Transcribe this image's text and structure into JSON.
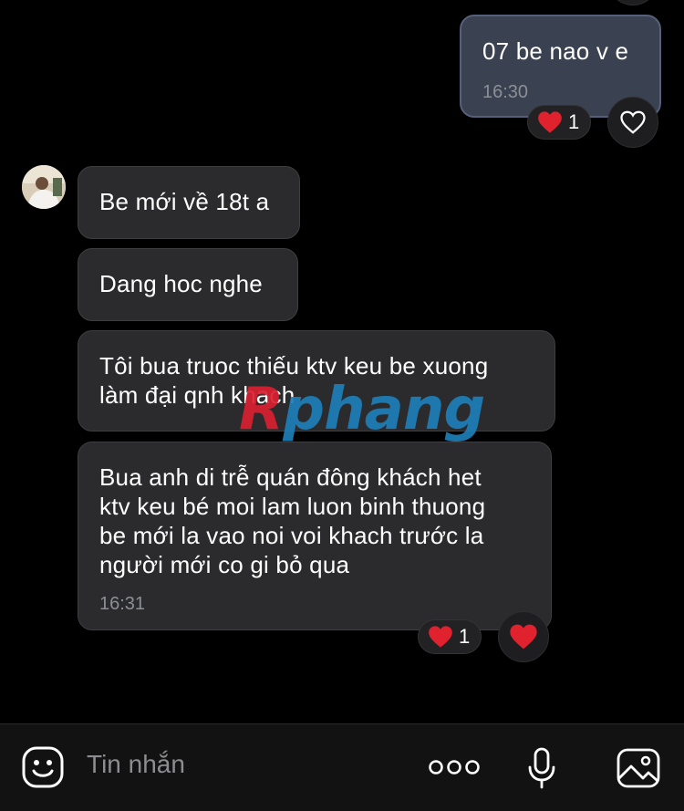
{
  "messages": [
    {
      "id": "m1",
      "direction": "outgoing",
      "text": "07 be nao v e",
      "time": "16:30",
      "reaction": {
        "emoji": "heart",
        "count": "1"
      }
    },
    {
      "id": "m2",
      "direction": "incoming",
      "text": "Be mới về 18t a"
    },
    {
      "id": "m3",
      "direction": "incoming",
      "text": "Dang hoc nghe"
    },
    {
      "id": "m4",
      "direction": "incoming",
      "text": "Tôi bua truoc thiếu ktv keu be xuong\nlàm đại qnh khach"
    },
    {
      "id": "m5",
      "direction": "incoming",
      "text": "Bua anh di trễ quán đông khách het\nktv keu bé moi lam luon binh thuong\nbe mới la vao noi voi khach trước la\nngười mới co gi bỏ qua",
      "time": "16:31",
      "reaction": {
        "emoji": "heart",
        "count": "1"
      }
    }
  ],
  "watermark": {
    "first": "R",
    "rest": "phang"
  },
  "composer": {
    "placeholder": "Tin nhắn"
  },
  "colors": {
    "background": "#000000",
    "outgoing_bubble": "#3a4150",
    "incoming_bubble": "#2b2b2d",
    "heart": "#e0212e",
    "muted_text": "#8b8f96"
  },
  "icons": [
    "smiley-icon",
    "more-icon",
    "microphone-icon",
    "image-icon",
    "heart-outline-icon",
    "heart-filled-icon"
  ]
}
